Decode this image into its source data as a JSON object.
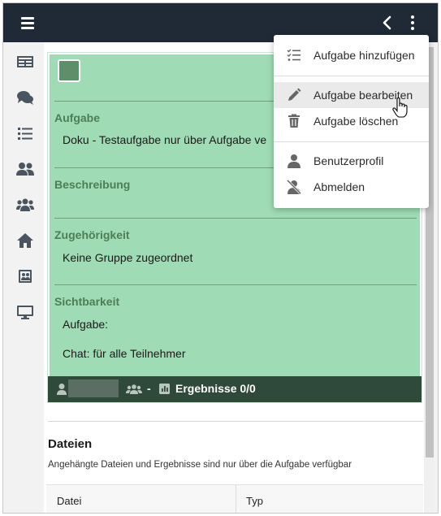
{
  "topbar": {
    "menu_icon": "hamburger-icon",
    "back_icon": "chevron-left-icon",
    "more_icon": "vertical-dots-icon",
    "bg_color": "#1f2a36"
  },
  "sidebar": {
    "items": [
      {
        "icon": "newspaper-icon"
      },
      {
        "icon": "chat-bubbles-icon"
      },
      {
        "icon": "task-list-icon"
      },
      {
        "icon": "users-icon"
      },
      {
        "icon": "group-icon"
      },
      {
        "icon": "home-icon"
      },
      {
        "icon": "contact-card-icon"
      },
      {
        "icon": "monitor-icon"
      }
    ]
  },
  "task": {
    "card_color": "#9fdbb4",
    "footer_color": "#2f4a3b",
    "sections": {
      "aufgabe_title": "Aufgabe",
      "aufgabe_value": "Doku - Testaufgabe nur über Aufgabe ve",
      "beschreibung_title": "Beschreibung",
      "beschreibung_value": "",
      "zugehoerigkeit_title": "Zugehörigkeit",
      "zugehoerigkeit_value": "Keine Gruppe zugeordnet",
      "sichtbarkeit_title": "Sichtbarkeit",
      "sichtbarkeit_aufgabe": "Aufgabe:",
      "sichtbarkeit_chat": "Chat: für alle Teilnehmer"
    },
    "footer": {
      "dash": "-",
      "results": "Ergebnisse 0/0"
    }
  },
  "files": {
    "heading": "Dateien",
    "subtitle": "Angehängte Dateien und Ergebnisse sind nur über die Aufgabe verfügbar",
    "columns": [
      "Datei",
      "Typ"
    ]
  },
  "dropdown": {
    "items": [
      {
        "label": "Aufgabe hinzufügen",
        "icon": "checklist-icon"
      },
      {
        "label": "Aufgabe bearbeiten",
        "icon": "pencil-icon"
      },
      {
        "label": "Aufgabe löschen",
        "icon": "trash-icon"
      },
      {
        "label": "Benutzerprofil",
        "icon": "user-icon"
      },
      {
        "label": "Abmelden",
        "icon": "user-slash-icon"
      }
    ],
    "active_index": 1
  }
}
